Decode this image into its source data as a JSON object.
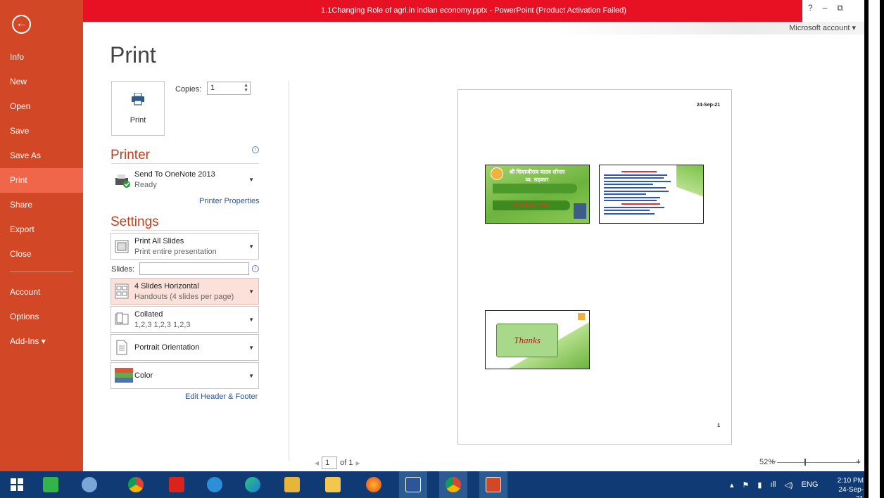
{
  "window": {
    "title": "1.1Changing Role of agri.in indian economy.pptx - PowerPoint (Product Activation Failed)",
    "help": "?",
    "minimize": "–",
    "restore": "⧉",
    "account": "Microsoft account ▾"
  },
  "sidebar": {
    "items": [
      {
        "label": "Info"
      },
      {
        "label": "New"
      },
      {
        "label": "Open"
      },
      {
        "label": "Save"
      },
      {
        "label": "Save As"
      },
      {
        "label": "Print",
        "active": true
      },
      {
        "label": "Share"
      },
      {
        "label": "Export"
      },
      {
        "label": "Close"
      },
      {
        "label": "Account"
      },
      {
        "label": "Options"
      },
      {
        "label": "Add-Ins ▾"
      }
    ]
  },
  "print": {
    "heading": "Print",
    "button_label": "Print",
    "copies_label": "Copies:",
    "copies_value": "1"
  },
  "printer": {
    "heading": "Printer",
    "name": "Send To OneNote 2013",
    "status": "Ready",
    "properties_link": "Printer Properties"
  },
  "settings": {
    "heading": "Settings",
    "range": {
      "title": "Print All Slides",
      "subtitle": "Print entire presentation"
    },
    "slides_label": "Slides:",
    "slides_value": "",
    "layout": {
      "title": "4 Slides Horizontal",
      "subtitle": "Handouts (4 slides per page)"
    },
    "collation": {
      "title": "Collated",
      "subtitle": "1,2,3   1,2,3   1,2,3"
    },
    "orientation": {
      "title": "Portrait Orientation"
    },
    "color": {
      "title": "Color"
    },
    "header_footer_link": "Edit Header & Footer"
  },
  "preview": {
    "date": "24-Sep-21",
    "page_number": "1",
    "slide1_title": "श्री शिवाजीराव यादव सोनार व्य. सहकार",
    "slide1_red": "डॉ. कविता कुमार अहार",
    "slide3_text": "Thanks"
  },
  "pagenav": {
    "current": "1",
    "of_label": "of 1"
  },
  "zoom": {
    "label": "52%",
    "level_percent": 52
  },
  "tray": {
    "lang": "ENG",
    "time": "2:10 PM",
    "date": "24-Sep-21"
  },
  "colors": {
    "accent": "#d24726",
    "active_nav": "#f0664a",
    "titlebar_error": "#e81123",
    "taskbar": "#0f3a73"
  }
}
